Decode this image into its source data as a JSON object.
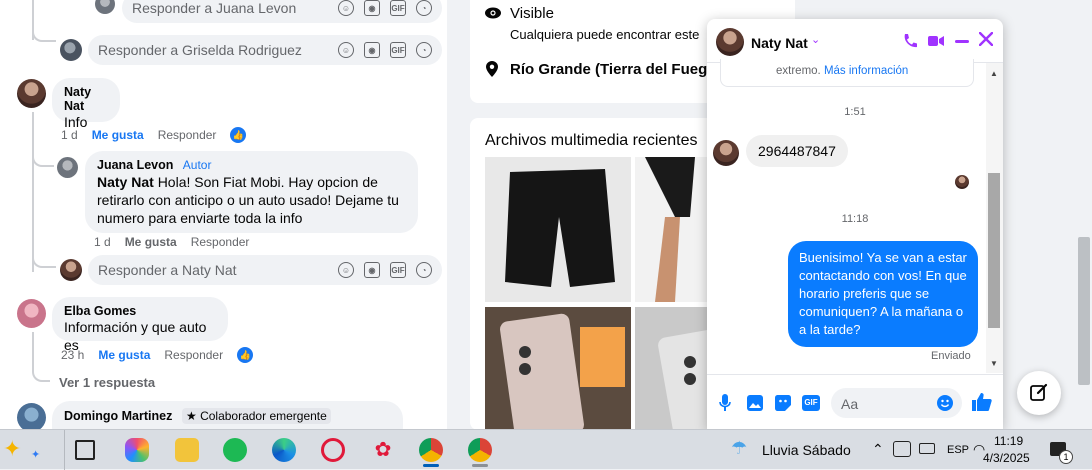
{
  "comments": {
    "top_reply_placeholder": "Responder a Juana Levon",
    "gris_reply_placeholder": "Responder a Griselda Rodriguez",
    "naty": {
      "name": "Naty Nat",
      "text": "Info",
      "time": "1 d",
      "like": "Me gusta",
      "reply": "Responder"
    },
    "juana": {
      "name": "Juana Levon",
      "badge": "Autor",
      "mention": "Naty Nat",
      "text": "Hola! Son Fiat Mobi. Hay opcion de retirarlo con anticipo o un auto usado! Dejame tu numero para enviarte toda la info",
      "time": "1 d",
      "like": "Me gusta",
      "reply": "Responder"
    },
    "naty_reply_placeholder": "Responder a Naty Nat",
    "elba": {
      "name": "Elba Gomes",
      "text": "Información y que auto es",
      "time": "23 h",
      "like": "Me gusta",
      "reply": "Responder"
    },
    "view_replies": "Ver 1 respuesta",
    "domingo": {
      "name": "Domingo Martinez",
      "badge": "Colaborador emergente"
    }
  },
  "info": {
    "visibility_title": "Visible",
    "visibility_desc": "Cualquiera puede encontrar este",
    "location": "Río Grande (Tierra del Fueg"
  },
  "media": {
    "title": "Archivos multimedia recientes"
  },
  "chat": {
    "name": "Naty Nat",
    "notice_tail": "extremo.",
    "notice_link": "Más información",
    "ts1": "1:51",
    "msg_in": "2964487847",
    "ts2": "11:18",
    "msg_out": "Buenisimo! Ya se van a estar contactando con vos! En que horario preferis que se comuniquen? A la mañana o a la tarde?",
    "status": "Enviado",
    "input_placeholder": "Aa"
  },
  "taskbar": {
    "weather": "Lluvia Sábado",
    "lang": "ESP",
    "time": "11:19",
    "date": "4/3/2025",
    "notif_count": "1"
  },
  "colors": {
    "accent": "#1877f2",
    "messenger_blue": "#0a7cff",
    "chat_purple": "#a033ff"
  }
}
